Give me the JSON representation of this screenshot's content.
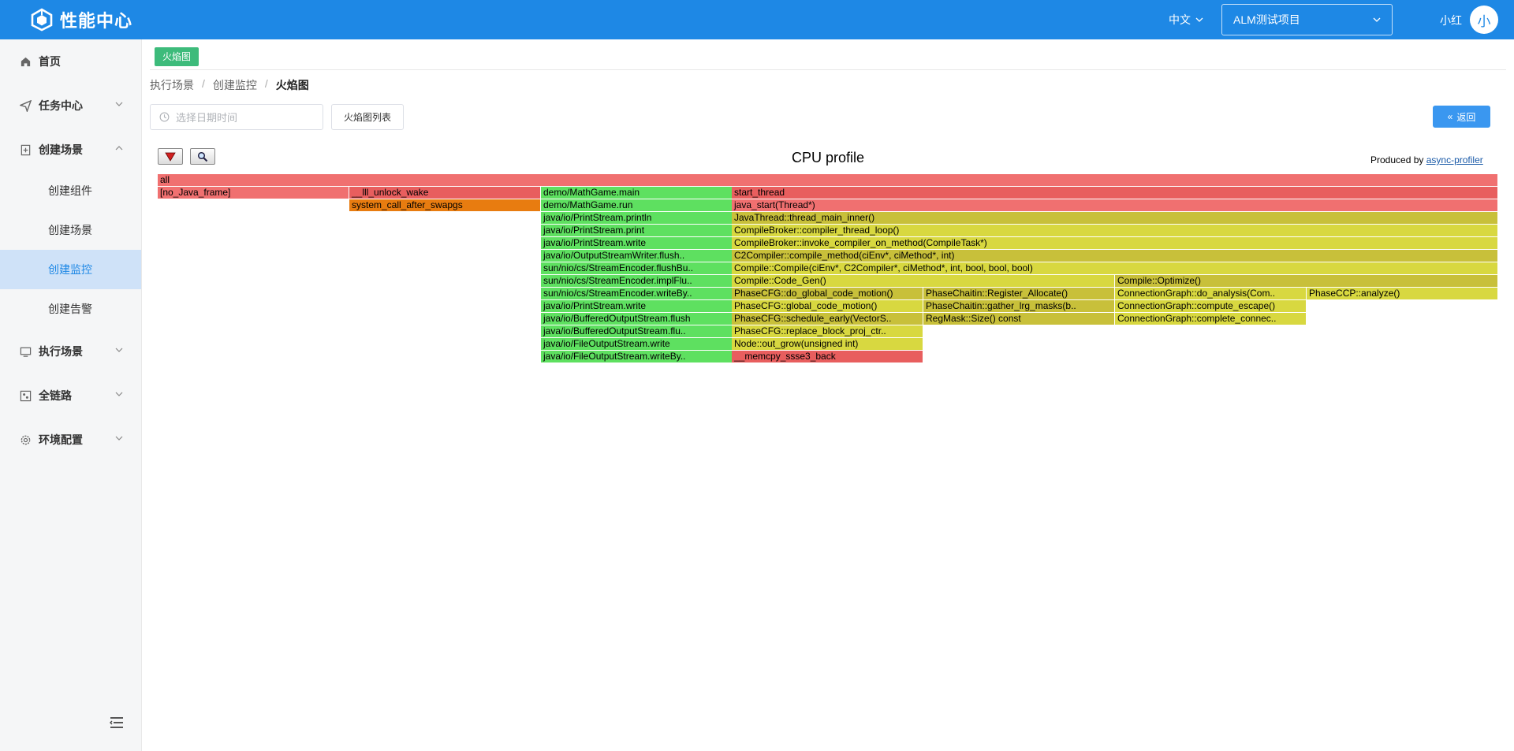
{
  "header": {
    "logo_text": "性能中心",
    "language": "中文",
    "project": "ALM测试项目",
    "user_name": "小红",
    "avatar_char": "小",
    "brand_color": "#1e88e5"
  },
  "sidebar": {
    "items": [
      {
        "label": "首页",
        "icon": "home-icon"
      },
      {
        "label": "任务中心",
        "icon": "send-icon"
      },
      {
        "label": "创建场景",
        "icon": "file-plus-icon"
      },
      {
        "label": "执行场景",
        "icon": "monitor-icon"
      },
      {
        "label": "全链路",
        "icon": "link-icon"
      },
      {
        "label": "环境配置",
        "icon": "gear-icon"
      }
    ],
    "sub_items": [
      "创建组件",
      "创建场景",
      "创建监控",
      "创建告警"
    ],
    "active_sub": "创建监控"
  },
  "tab": {
    "label": "火焰图"
  },
  "breadcrumb": [
    "执行场景",
    "创建监控",
    "火焰图"
  ],
  "toolbar": {
    "date_placeholder": "选择日期时间",
    "list_button": "火焰图列表",
    "back_button": "返回"
  },
  "flamegraph": {
    "title": "CPU profile",
    "produced_by": "Produced by",
    "producer_link": "async-profiler",
    "colors": {
      "red": "#f07070",
      "dark_red": "#e85e5e",
      "orange": "#e87c10",
      "green": "#5ee060",
      "yellow": "#d8d840",
      "olive": "#c8c03a"
    },
    "frames": [
      {
        "label": "all",
        "row": 0,
        "start": 0,
        "span": 1.0,
        "color": "red"
      },
      {
        "label": "[no_Java_frame]",
        "row": 1,
        "start": 0,
        "span": 0.1428,
        "color": "red"
      },
      {
        "label": "__lll_unlock_wake",
        "row": 1,
        "start": 0.1428,
        "span": 0.1428,
        "color": "dark_red"
      },
      {
        "label": "demo/MathGame.main",
        "row": 1,
        "start": 0.2856,
        "span": 0.1428,
        "color": "green"
      },
      {
        "label": "start_thread",
        "row": 1,
        "start": 0.4284,
        "span": 0.5716,
        "color": "dark_red"
      },
      {
        "label": "system_call_after_swapgs",
        "row": 2,
        "start": 0.1428,
        "span": 0.1428,
        "color": "orange"
      },
      {
        "label": "demo/MathGame.run",
        "row": 2,
        "start": 0.2856,
        "span": 0.1428,
        "color": "green"
      },
      {
        "label": "java_start(Thread*)",
        "row": 2,
        "start": 0.4284,
        "span": 0.5716,
        "color": "red"
      },
      {
        "label": "java/io/PrintStream.println",
        "row": 3,
        "start": 0.2856,
        "span": 0.1428,
        "color": "green"
      },
      {
        "label": "JavaThread::thread_main_inner()",
        "row": 3,
        "start": 0.4284,
        "span": 0.5716,
        "color": "olive"
      },
      {
        "label": "java/io/PrintStream.print",
        "row": 4,
        "start": 0.2856,
        "span": 0.1428,
        "color": "green"
      },
      {
        "label": "CompileBroker::compiler_thread_loop()",
        "row": 4,
        "start": 0.4284,
        "span": 0.5716,
        "color": "yellow"
      },
      {
        "label": "java/io/PrintStream.write",
        "row": 5,
        "start": 0.2856,
        "span": 0.1428,
        "color": "green"
      },
      {
        "label": "CompileBroker::invoke_compiler_on_method(CompileTask*)",
        "row": 5,
        "start": 0.4284,
        "span": 0.5716,
        "color": "yellow"
      },
      {
        "label": "java/io/OutputStreamWriter.flush..",
        "row": 6,
        "start": 0.2856,
        "span": 0.1428,
        "color": "green"
      },
      {
        "label": "C2Compiler::compile_method(ciEnv*, ciMethod*, int)",
        "row": 6,
        "start": 0.4284,
        "span": 0.5716,
        "color": "olive"
      },
      {
        "label": "sun/nio/cs/StreamEncoder.flushBu..",
        "row": 7,
        "start": 0.2856,
        "span": 0.1428,
        "color": "green"
      },
      {
        "label": "Compile::Compile(ciEnv*, C2Compiler*, ciMethod*, int, bool, bool, bool)",
        "row": 7,
        "start": 0.4284,
        "span": 0.5716,
        "color": "yellow"
      },
      {
        "label": "sun/nio/cs/StreamEncoder.implFlu..",
        "row": 8,
        "start": 0.2856,
        "span": 0.1428,
        "color": "green"
      },
      {
        "label": "Compile::Code_Gen()",
        "row": 8,
        "start": 0.4284,
        "span": 0.2858,
        "color": "yellow"
      },
      {
        "label": "Compile::Optimize()",
        "row": 8,
        "start": 0.7142,
        "span": 0.2858,
        "color": "olive"
      },
      {
        "label": "sun/nio/cs/StreamEncoder.writeBy..",
        "row": 9,
        "start": 0.2856,
        "span": 0.1428,
        "color": "green"
      },
      {
        "label": "PhaseCFG::do_global_code_motion()",
        "row": 9,
        "start": 0.4284,
        "span": 0.1429,
        "color": "olive"
      },
      {
        "label": "PhaseChaitin::Register_Allocate()",
        "row": 9,
        "start": 0.5713,
        "span": 0.1429,
        "color": "olive"
      },
      {
        "label": "ConnectionGraph::do_analysis(Com..",
        "row": 9,
        "start": 0.7142,
        "span": 0.1429,
        "color": "yellow"
      },
      {
        "label": "PhaseCCP::analyze()",
        "row": 9,
        "start": 0.8571,
        "span": 0.1429,
        "color": "yellow"
      },
      {
        "label": "java/io/PrintStream.write",
        "row": 10,
        "start": 0.2856,
        "span": 0.1428,
        "color": "green"
      },
      {
        "label": "PhaseCFG::global_code_motion()",
        "row": 10,
        "start": 0.4284,
        "span": 0.1429,
        "color": "yellow"
      },
      {
        "label": "PhaseChaitin::gather_lrg_masks(b..",
        "row": 10,
        "start": 0.5713,
        "span": 0.1429,
        "color": "olive"
      },
      {
        "label": "ConnectionGraph::compute_escape()",
        "row": 10,
        "start": 0.7142,
        "span": 0.1429,
        "color": "yellow"
      },
      {
        "label": "java/io/BufferedOutputStream.flush",
        "row": 11,
        "start": 0.2856,
        "span": 0.1428,
        "color": "green"
      },
      {
        "label": "PhaseCFG::schedule_early(VectorS..",
        "row": 11,
        "start": 0.4284,
        "span": 0.1429,
        "color": "olive"
      },
      {
        "label": "RegMask::Size() const",
        "row": 11,
        "start": 0.5713,
        "span": 0.1429,
        "color": "olive"
      },
      {
        "label": "ConnectionGraph::complete_connec..",
        "row": 11,
        "start": 0.7142,
        "span": 0.1429,
        "color": "yellow"
      },
      {
        "label": "java/io/BufferedOutputStream.flu..",
        "row": 12,
        "start": 0.2856,
        "span": 0.1428,
        "color": "green"
      },
      {
        "label": "PhaseCFG::replace_block_proj_ctr..",
        "row": 12,
        "start": 0.4284,
        "span": 0.1429,
        "color": "yellow"
      },
      {
        "label": "java/io/FileOutputStream.write",
        "row": 13,
        "start": 0.2856,
        "span": 0.1428,
        "color": "green"
      },
      {
        "label": "Node::out_grow(unsigned int)",
        "row": 13,
        "start": 0.4284,
        "span": 0.1429,
        "color": "yellow"
      },
      {
        "label": "java/io/FileOutputStream.writeBy..",
        "row": 14,
        "start": 0.2856,
        "span": 0.1428,
        "color": "green"
      },
      {
        "label": "__memcpy_ssse3_back",
        "row": 14,
        "start": 0.4284,
        "span": 0.1429,
        "color": "dark_red"
      }
    ]
  }
}
